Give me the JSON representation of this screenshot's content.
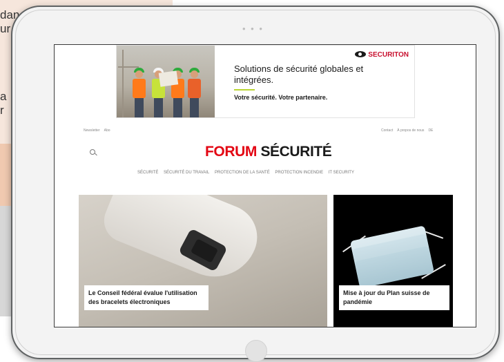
{
  "background": {
    "text_lines": [
      "dan",
      "ur",
      "",
      "",
      "",
      "a",
      "r"
    ]
  },
  "ad": {
    "headline": "Solutions de sécurité globales et intégrées.",
    "tagline": "Votre sécurité. Votre partenaire.",
    "brand": "SECURITON",
    "brand_color": "#c8102e",
    "accent_color": "#b9d531"
  },
  "header": {
    "left_links": [
      "Newsletter",
      "Abo"
    ],
    "right_links": [
      "Contact",
      "À propos de nous",
      "DE"
    ],
    "logo_part1": "FORUM",
    "logo_part2": "SÉCURITÉ",
    "logo_color": "#e30613"
  },
  "nav": {
    "items": [
      "SÉCURITÉ",
      "SÉCURITÉ DU TRAVAIL",
      "PROTECTION DE LA SANTÉ",
      "PROTECTION INCENDIE",
      "IT SECURITY"
    ]
  },
  "articles": [
    {
      "title": "Le Conseil fédéral évalue l'utilisation des bracelets électroniques"
    },
    {
      "title": "Mise à jour du Plan suisse de pandémie"
    }
  ]
}
